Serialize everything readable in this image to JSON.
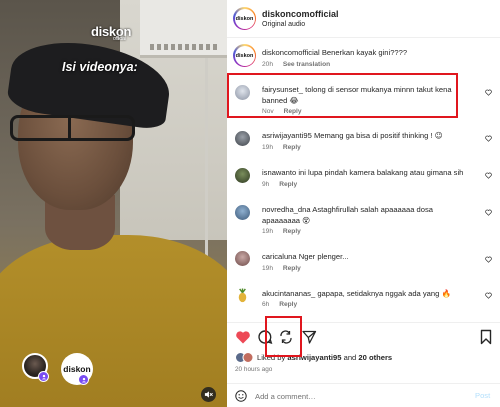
{
  "video": {
    "brand_text": "diskon",
    "brand_accent": "o",
    "brand_sub": "offlicial",
    "caption": "Isi videonya:",
    "right_avatar_text": "diskon",
    "colors": {
      "badge": "#7a4df2"
    }
  },
  "post": {
    "username": "diskoncomofficial",
    "audio": "Original audio",
    "avatar_text": "diskon"
  },
  "comments": [
    {
      "user": "diskoncomofficial",
      "text": "Benerkan kayak gini????",
      "time": "20h",
      "action": "See translation"
    },
    {
      "user": "fairysunset_",
      "text": "tolong di sensor mukanya minnn takut kena banned 😂",
      "time": "Nov",
      "action": "Reply"
    },
    {
      "user": "asriwijayanti95",
      "text": "Memang ga bisa di positif thinking ! 😉",
      "time": "19h",
      "action": "Reply"
    },
    {
      "user": "isnawanto",
      "text": "ini lupa pindah kamera balakang atau gimana sih",
      "time": "9h",
      "action": "Reply"
    },
    {
      "user": "novredha_dna",
      "text": "Astaghfirullah salah apaaaaaa dosa apaaaaaaa 😵",
      "time": "19h",
      "action": "Reply"
    },
    {
      "user": "caricaluna",
      "text": "Nger plenger...",
      "time": "19h",
      "action": "Reply"
    },
    {
      "user": "akucintananas_",
      "text": "gapapa, setidaknya nggak ada yang 🔥",
      "time": "6h",
      "action": "Reply"
    }
  ],
  "likes": {
    "prefix": "Liked by",
    "user": "asriwijayanti95",
    "and": "and",
    "others": "20 others"
  },
  "timestamp": "20 hours ago",
  "add_comment": {
    "placeholder": "Add a comment…",
    "post_label": "Post"
  },
  "colors": {
    "like_red": "#ed4956",
    "highlight": "#e0161e",
    "post_blue": "#b2dffc"
  }
}
